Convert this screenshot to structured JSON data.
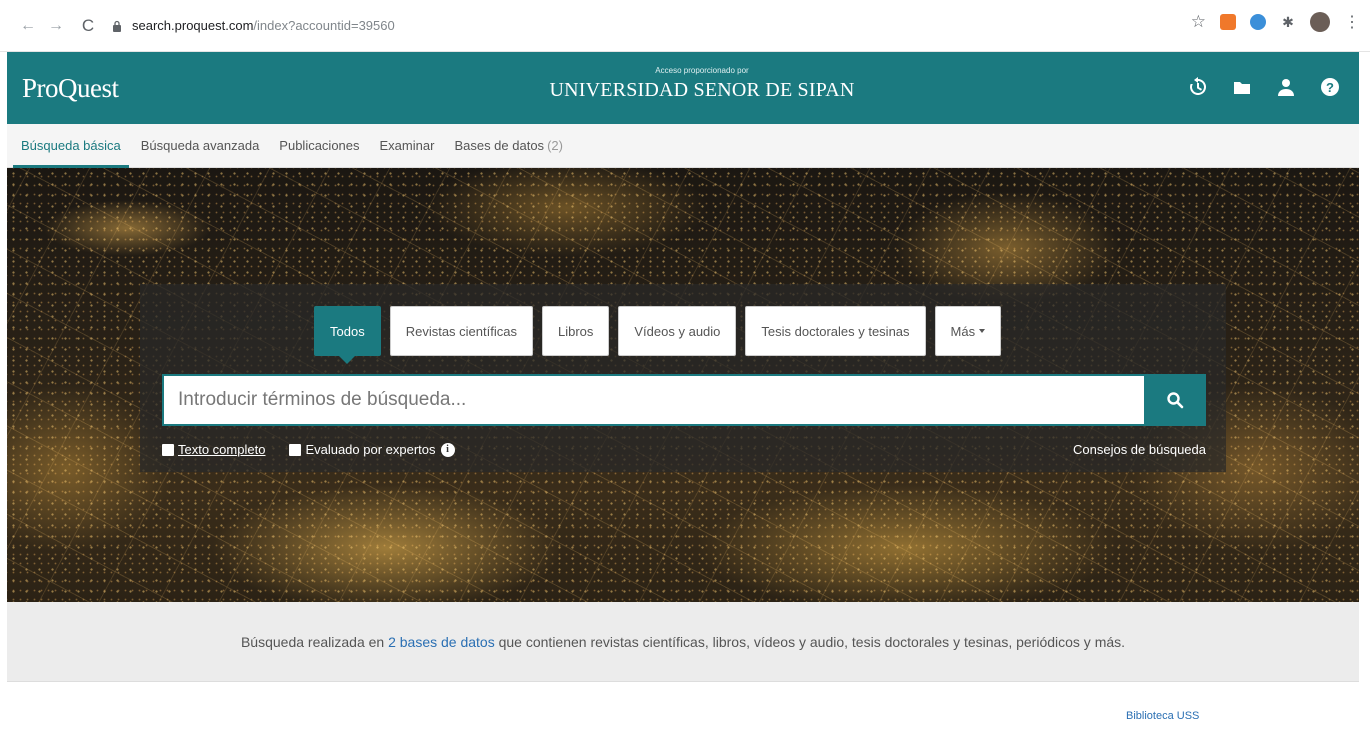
{
  "browser": {
    "url_host": "search.proquest.com",
    "url_path": "/index?accountid=39560"
  },
  "header": {
    "logo": "ProQuest",
    "access_label": "Acceso proporcionado por",
    "institution": "UNIVERSIDAD SENOR DE SIPAN",
    "icons": [
      "history-icon",
      "folder-icon",
      "user-icon",
      "help-icon"
    ]
  },
  "nav": {
    "items": [
      {
        "label": "Búsqueda básica",
        "active": true
      },
      {
        "label": "Búsqueda avanzada"
      },
      {
        "label": "Publicaciones"
      },
      {
        "label": "Examinar"
      },
      {
        "label": "Bases de datos",
        "count": "(2)"
      }
    ]
  },
  "search": {
    "tabs": [
      "Todos",
      "Revistas científicas",
      "Libros",
      "Vídeos y audio",
      "Tesis doctorales y tesinas",
      "Más"
    ],
    "placeholder": "Introducir términos de búsqueda...",
    "opt_fulltext": "Texto completo",
    "opt_peer": "Evaluado por expertos",
    "tips": "Consejos de búsqueda"
  },
  "info": {
    "prefix": "Búsqueda realizada en ",
    "link": "2 bases de datos",
    "suffix": " que contienen revistas científicas, libros, vídeos y audio, tesis doctorales y tesinas, periódicos y más."
  },
  "footer": {
    "link": "Biblioteca USS"
  },
  "colors": {
    "brand": "#1b7a80",
    "link": "#2a6fb3"
  }
}
